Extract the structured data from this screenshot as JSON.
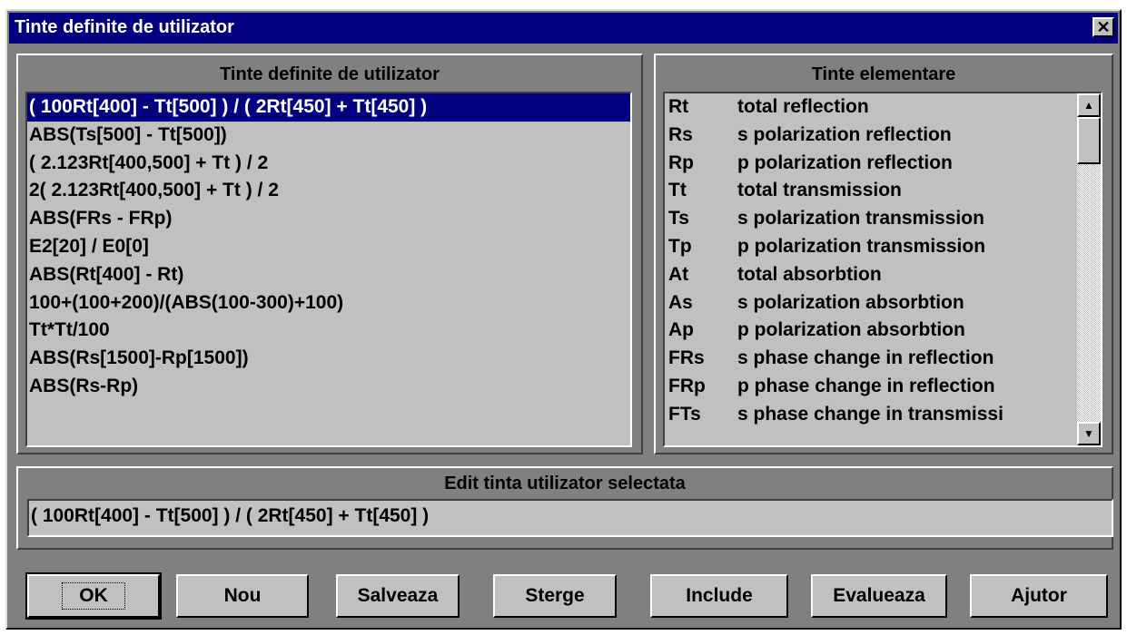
{
  "window": {
    "title": "Tinte definite de utilizator",
    "close_glyph": "✕"
  },
  "user_targets": {
    "title": "Tinte definite de utilizator",
    "selected_index": 0,
    "items": [
      "( 100Rt[400] - Tt[500] ) / ( 2Rt[450] + Tt[450] )",
      "ABS(Ts[500] - Tt[500])",
      "( 2.123Rt[400,500] + Tt ) / 2",
      "2( 2.123Rt[400,500] + Tt ) / 2",
      "ABS(FRs - FRp)",
      "E2[20] / E0[0]",
      "ABS(Rt[400] - Rt)",
      "100+(100+200)/(ABS(100-300)+100)",
      "Tt*Tt/100",
      "ABS(Rs[1500]-Rp[1500])",
      "ABS(Rs-Rp)"
    ]
  },
  "elementary_targets": {
    "title": "Tinte elementare",
    "items": [
      {
        "code": "Rt",
        "desc": "total reflection"
      },
      {
        "code": "Rs",
        "desc": "s polarization reflection"
      },
      {
        "code": "Rp",
        "desc": "p polarization reflection"
      },
      {
        "code": "Tt",
        "desc": "total transmission"
      },
      {
        "code": "Ts",
        "desc": "s polarization transmission"
      },
      {
        "code": "Tp",
        "desc": "p polarization transmission"
      },
      {
        "code": "At",
        "desc": "total absorbtion"
      },
      {
        "code": "As",
        "desc": "s polarization absorbtion"
      },
      {
        "code": "Ap",
        "desc": "p polarization absorbtion"
      },
      {
        "code": "FRs",
        "desc": "s phase change in reflection"
      },
      {
        "code": "FRp",
        "desc": "p phase change in reflection"
      },
      {
        "code": "FTs",
        "desc": "s phase change in transmissi"
      }
    ],
    "scroll_up_glyph": "▲",
    "scroll_down_glyph": "▼"
  },
  "edit": {
    "title": "Edit tinta utilizator selectata",
    "value": "( 100Rt[400] - Tt[500] ) / ( 2Rt[450] + Tt[450] )"
  },
  "buttons": {
    "ok": "OK",
    "new": "Nou",
    "save": "Salveaza",
    "delete": "Sterge",
    "include": "Include",
    "evaluate": "Evalueaza",
    "help": "Ajutor"
  },
  "colors": {
    "titlebar": "#000080",
    "selection": "#000080",
    "face": "#c0c0c0",
    "frame": "#808080"
  }
}
